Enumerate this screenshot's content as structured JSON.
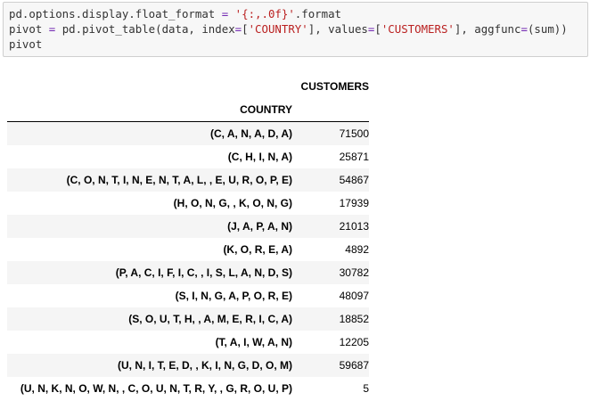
{
  "code_cell": {
    "lines": [
      {
        "parts": [
          {
            "t": "pd.options.display.float_format ",
            "c": ""
          },
          {
            "t": "=",
            "c": "op"
          },
          {
            "t": " ",
            "c": ""
          },
          {
            "t": "'{:,.0f}'",
            "c": "str"
          },
          {
            "t": ".format",
            "c": ""
          }
        ]
      },
      {
        "parts": [
          {
            "t": "pivot ",
            "c": ""
          },
          {
            "t": "=",
            "c": "op"
          },
          {
            "t": " pd.pivot_table(data, index",
            "c": ""
          },
          {
            "t": "=",
            "c": "op"
          },
          {
            "t": "[",
            "c": ""
          },
          {
            "t": "'COUNTRY'",
            "c": "str"
          },
          {
            "t": "], values",
            "c": ""
          },
          {
            "t": "=",
            "c": "op"
          },
          {
            "t": "[",
            "c": ""
          },
          {
            "t": "'CUSTOMERS'",
            "c": "str"
          },
          {
            "t": "], aggfunc",
            "c": ""
          },
          {
            "t": "=",
            "c": "op"
          },
          {
            "t": "(sum))",
            "c": ""
          }
        ]
      },
      {
        "parts": [
          {
            "t": "pivot",
            "c": ""
          }
        ]
      }
    ]
  },
  "table": {
    "value_column": "CUSTOMERS",
    "index_name": "COUNTRY",
    "rows": [
      {
        "index": "(C, A, N, A, D, A)",
        "value": "71500"
      },
      {
        "index": "(C, H, I, N, A)",
        "value": "25871"
      },
      {
        "index": "(C, O, N, T, I, N, E, N, T, A, L, , E, U, R, O, P, E)",
        "value": "54867"
      },
      {
        "index": "(H, O, N, G, , K, O, N, G)",
        "value": "17939"
      },
      {
        "index": "(J, A, P, A, N)",
        "value": "21013"
      },
      {
        "index": "(K, O, R, E, A)",
        "value": "4892"
      },
      {
        "index": "(P, A, C, I, F, I, C, , I, S, L, A, N, D, S)",
        "value": "30782"
      },
      {
        "index": "(S, I, N, G, A, P, O, R, E)",
        "value": "48097"
      },
      {
        "index": "(S, O, U, T, H, , A, M, E, R, I, C, A)",
        "value": "18852"
      },
      {
        "index": "(T, A, I, W, A, N)",
        "value": "12205"
      },
      {
        "index": "(U, N, I, T, E, D, , K, I, N, G, D, O, M)",
        "value": "59687"
      },
      {
        "index": "(U, N, K, N, O, W, N, , C, O, U, N, T, R, Y, , G, R, O, U, P)",
        "value": "5"
      }
    ]
  }
}
